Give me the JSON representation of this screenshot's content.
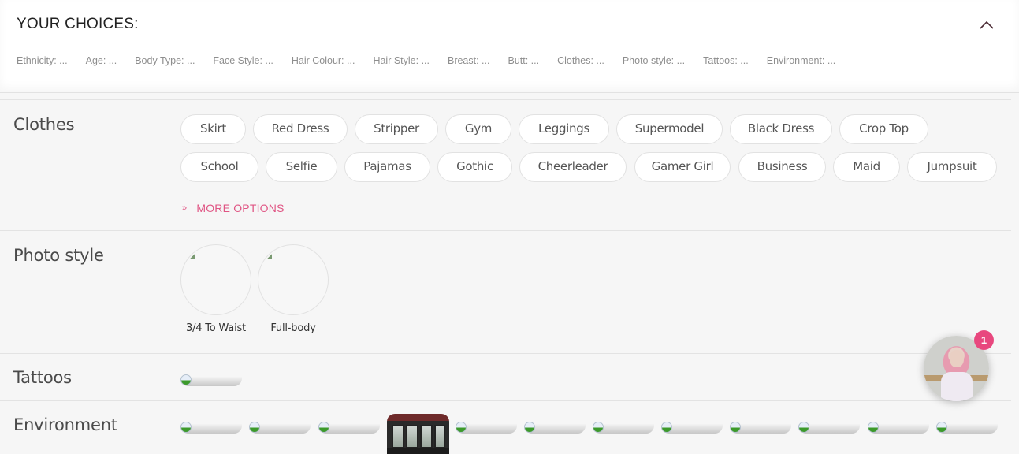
{
  "choices": {
    "title": "YOUR CHOICES:",
    "collapse_icon": "chevron-up-icon",
    "items": [
      "Ethnicity: ...",
      "Age: ...",
      "Body Type: ...",
      "Face Style: ...",
      "Hair Colour: ...",
      "Hair Style: ...",
      "Breast: ...",
      "Butt: ...",
      "Clothes: ...",
      "Photo style: ...",
      "Tattoos: ...",
      "Environment: ..."
    ]
  },
  "clothes": {
    "label": "Clothes",
    "options_row1": [
      "Skirt",
      "Red Dress",
      "Stripper",
      "Gym",
      "Leggings",
      "Supermodel",
      "Black Dress",
      "Crop Top"
    ],
    "options_row2": [
      "School",
      "Selfie",
      "Pajamas",
      "Gothic",
      "Cheerleader",
      "Gamer Girl",
      "Business",
      "Maid",
      "Jumpsuit"
    ],
    "more_options_label": "MORE OPTIONS",
    "more_options_icon": "double-chevron-down-icon"
  },
  "photo_style": {
    "label": "Photo style",
    "options": [
      "3/4 To Waist",
      "Full-body"
    ]
  },
  "tattoos": {
    "label": "Tattoos"
  },
  "environment": {
    "label": "Environment"
  },
  "chat": {
    "badge_count": "1"
  },
  "colors": {
    "accent": "#e05584",
    "badge": "#e8477e",
    "background": "#f6f6f6",
    "panel": "#ffffff"
  }
}
